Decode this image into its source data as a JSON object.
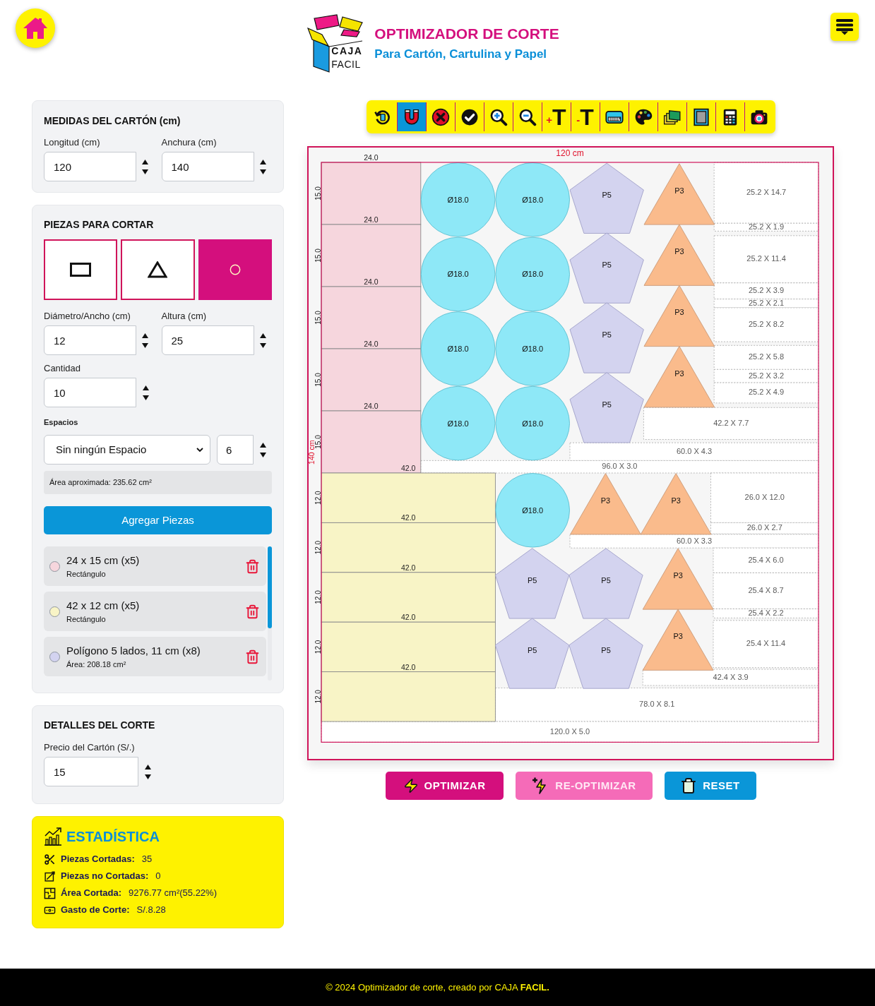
{
  "header": {
    "logo": {
      "line_1": "CAJA",
      "line_2": "FACIL"
    },
    "title": "OPTIMIZADOR DE CORTE",
    "subtitle": "Para Cartón, Cartulina y Papel"
  },
  "board_panel": {
    "title": "MEDIDAS DEL CARTÓN (cm)",
    "fields": [
      {
        "label": "Longitud (cm)",
        "value": "120"
      },
      {
        "label": "Anchura (cm)",
        "value": "140"
      }
    ]
  },
  "pieces_panel": {
    "title": "PIEZAS PARA CORTAR",
    "shapes": [
      {
        "kind": "rectangle",
        "selected": false
      },
      {
        "kind": "triangle",
        "selected": false
      },
      {
        "kind": "circle",
        "selected": true
      }
    ],
    "fields": [
      {
        "label": "Diámetro/Ancho (cm)",
        "value": "12"
      },
      {
        "label": "Altura (cm)",
        "value": "25"
      },
      {
        "label": "Cantidad",
        "value": "10"
      }
    ],
    "spacing": {
      "label": "Espacios",
      "option": "Sin ningún Espacio",
      "value": "6"
    },
    "area_note": "Área aproximada: 235.62 cm²",
    "add_button": "Agregar Piezas",
    "pieces": [
      {
        "title": "24 x 15 cm (x5)",
        "detail": "Rectángulo",
        "color": "#f6d6dd"
      },
      {
        "title": "42 x 12 cm (x5)",
        "detail": "Rectángulo",
        "color": "#f8f4c6"
      },
      {
        "title": "Polígono 5 lados, 11 cm (x8)",
        "detail": "Área: 208.18 cm²",
        "color": "#d3d3f0"
      }
    ]
  },
  "cut_panel": {
    "title": "DETALLES DEL CORTE",
    "fields": [
      {
        "label": "Precio del Cartón (S/.)",
        "value": "15"
      }
    ]
  },
  "stats": {
    "title": "ESTADÍSTICA",
    "rows": [
      {
        "kind": "scissors",
        "label": "Piezas Cortadas:",
        "value": "35"
      },
      {
        "kind": "uncut",
        "label": "Piezas no Cortadas:",
        "value": "0"
      },
      {
        "kind": "area",
        "label": "Área Cortada:",
        "value": "9276.77 cm²(55.22%)"
      },
      {
        "kind": "cost",
        "label": "Gasto de Corte:",
        "value": "S/.8.28"
      }
    ]
  },
  "toolbar": [
    {
      "kind": "rotate",
      "selected": false
    },
    {
      "kind": "magnet",
      "selected": true
    },
    {
      "kind": "delete",
      "selected": false
    },
    {
      "kind": "confirm",
      "selected": false
    },
    {
      "kind": "zoom_in",
      "selected": false
    },
    {
      "kind": "zoom_out",
      "selected": false
    },
    {
      "kind": "text_larger",
      "sign": "+",
      "letter": "T",
      "selected": false
    },
    {
      "kind": "text_smaller",
      "sign": "-",
      "letter": "T",
      "selected": false
    },
    {
      "kind": "ruler",
      "selected": false
    },
    {
      "kind": "palette",
      "selected": false
    },
    {
      "kind": "layers",
      "selected": false
    },
    {
      "kind": "frame",
      "selected": false
    },
    {
      "kind": "calculator",
      "selected": false
    },
    {
      "kind": "camera",
      "selected": false
    }
  ],
  "canvas": {
    "width_label": "120 cm",
    "height_label": "140 cm",
    "rectangles": [
      {
        "width_label": "24.0",
        "height_label": "15.0",
        "color": "#f6d6dd"
      },
      {
        "width_label": "24.0",
        "height_label": "15.0",
        "color": "#f6d6dd"
      },
      {
        "width_label": "24.0",
        "height_label": "15.0",
        "color": "#f6d6dd"
      },
      {
        "width_label": "24.0",
        "height_label": "15.0",
        "color": "#f6d6dd"
      },
      {
        "width_label": "24.0",
        "height_label": "15.0",
        "color": "#f6d6dd"
      },
      {
        "width_label": "42.0",
        "height_label": "12.0",
        "color": "#f8f4c6"
      },
      {
        "width_label": "42.0",
        "height_label": "12.0",
        "color": "#f8f4c6"
      },
      {
        "width_label": "42.0",
        "height_label": "12.0",
        "color": "#f8f4c6"
      },
      {
        "width_label": "42.0",
        "height_label": "12.0",
        "color": "#f8f4c6"
      },
      {
        "width_label": "42.0",
        "height_label": "12.0",
        "color": "#f8f4c6"
      }
    ],
    "circles": [
      {
        "label": "Ø18.0"
      },
      {
        "label": "Ø18.0"
      },
      {
        "label": "Ø18.0"
      },
      {
        "label": "Ø18.0"
      },
      {
        "label": "Ø18.0"
      },
      {
        "label": "Ø18.0"
      },
      {
        "label": "Ø18.0"
      },
      {
        "label": "Ø18.0"
      },
      {
        "label": "Ø18.0"
      }
    ],
    "pentagons": [
      {
        "label": "P5"
      },
      {
        "label": "P5"
      },
      {
        "label": "P5"
      },
      {
        "label": "P5"
      },
      {
        "label": "P5"
      },
      {
        "label": "P5"
      },
      {
        "label": "P5"
      },
      {
        "label": "P5"
      }
    ],
    "triangles": [
      {
        "label": "P3"
      },
      {
        "label": "P3"
      },
      {
        "label": "P3"
      },
      {
        "label": "P3"
      },
      {
        "label": "P3"
      },
      {
        "label": "P3"
      },
      {
        "label": "P3"
      },
      {
        "label": "P3"
      }
    ],
    "offcuts": [
      {
        "label": "25.2 X 14.7"
      },
      {
        "label": "25.2 X 1.9"
      },
      {
        "label": "25.2 X 11.4"
      },
      {
        "label": "25.2 X 3.9"
      },
      {
        "label": "25.2 X 2.1"
      },
      {
        "label": "25.2 X 8.2"
      },
      {
        "label": "25.2 X 5.8"
      },
      {
        "label": "25.2 X 3.2"
      },
      {
        "label": "25.2 X 4.9"
      },
      {
        "label": "42.2 X 7.7"
      },
      {
        "label": "60.0 X 4.3"
      },
      {
        "label": "96.0 X 3.0"
      },
      {
        "label": "26.0 X 12.0"
      },
      {
        "label": "26.0 X 2.7"
      },
      {
        "label": "60.0 X 3.3"
      },
      {
        "label": "25.4 X 6.0"
      },
      {
        "label": "25.4 X 8.7"
      },
      {
        "label": "25.4 X 2.2"
      },
      {
        "label": "25.4 X 11.4"
      },
      {
        "label": "42.4 X 3.9"
      },
      {
        "label": "78.0 X 8.1"
      },
      {
        "label": "120.0 X 5.0"
      }
    ]
  },
  "actions": [
    {
      "kind": "optimize",
      "label": "OPTIMIZAR"
    },
    {
      "kind": "reoptimize",
      "label": "RE-OPTIMIZAR"
    },
    {
      "kind": "reset",
      "label": "RESET"
    }
  ],
  "footer": "© 2024 Optimizador de corte, creado por CAJA **FACIL.**"
}
